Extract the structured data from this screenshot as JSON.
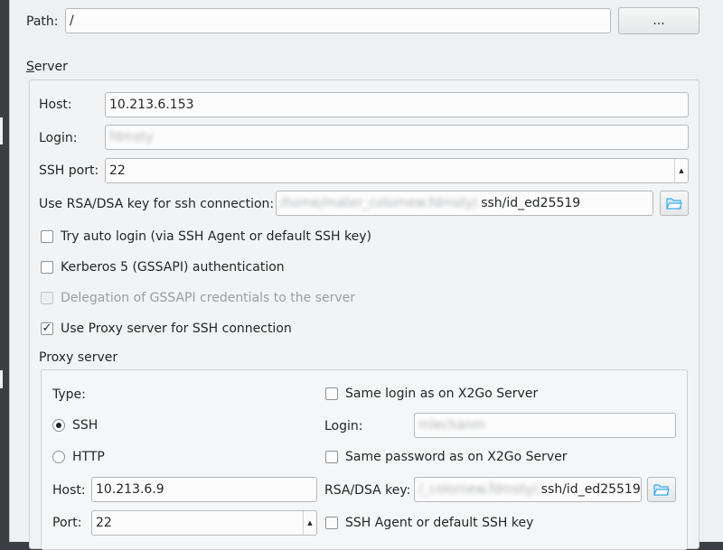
{
  "path": {
    "label": "Path:",
    "value": "/",
    "browse_label": "..."
  },
  "server": {
    "title": "Server",
    "host": {
      "label": "Host:",
      "value": "10.213.6.153"
    },
    "login": {
      "label": "Login:",
      "value": "fdmsty"
    },
    "ssh_port": {
      "label": "SSH port:",
      "value": "22"
    },
    "rsa_key": {
      "label": "Use RSA/DSA key for ssh connection:",
      "value_hidden": "/home/mater_colornew.fdmsty/.",
      "value_visible": "ssh/id_ed25519"
    },
    "auto_login": {
      "label": "Try auto login (via SSH Agent or default SSH key)",
      "checked": false
    },
    "kerberos": {
      "label": "Kerberos 5 (GSSAPI) authentication",
      "checked": false
    },
    "delegation": {
      "label": "Delegation of GSSAPI credentials to the server",
      "checked": false,
      "enabled": false
    },
    "use_proxy": {
      "label": "Use Proxy server for SSH connection",
      "checked": true
    }
  },
  "proxy": {
    "title": "Proxy server",
    "type_label": "Type:",
    "type_options": [
      {
        "label": "SSH",
        "selected": true
      },
      {
        "label": "HTTP",
        "selected": false
      }
    ],
    "host": {
      "label": "Host:",
      "value": "10.213.6.9"
    },
    "port": {
      "label": "Port:",
      "value": "22"
    },
    "same_login": {
      "label": "Same login as on X2Go Server",
      "checked": false
    },
    "login": {
      "label": "Login:",
      "value": "mlechanm"
    },
    "same_password": {
      "label": "Same password as on X2Go Server",
      "checked": false
    },
    "rsa_key": {
      "label": "RSA/DSA key:",
      "value_hidden": "/_colornew.fdmsty/.",
      "value_visible": "ssh/id_ed25519"
    },
    "ssh_agent": {
      "label": "SSH Agent or default SSH key",
      "checked": false
    }
  },
  "icons": {
    "folder": "folder-open-icon",
    "check": "✓",
    "spin_up": "▲",
    "spin_down": "▼"
  },
  "colors": {
    "window_bg": "#eff0f1",
    "folder_accent": "#3daee9"
  }
}
